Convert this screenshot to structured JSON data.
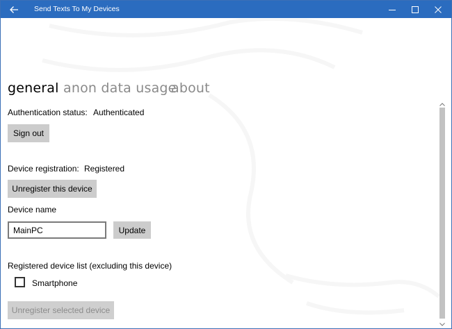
{
  "window": {
    "title": "Send Texts To My Devices",
    "accent_color": "#2b6cbf"
  },
  "titlebar": {
    "back_icon": "back-arrow-icon",
    "minimize_icon": "minimize-icon",
    "maximize_icon": "maximize-icon",
    "close_icon": "close-icon"
  },
  "pivot": {
    "tabs": [
      {
        "label": "general",
        "selected": true
      },
      {
        "label": "anon data usage",
        "selected": false
      },
      {
        "label": "about",
        "selected": false
      }
    ]
  },
  "auth": {
    "label": "Authentication status:",
    "value": "Authenticated",
    "sign_out_label": "Sign out"
  },
  "registration": {
    "label": "Device registration:",
    "value": "Registered",
    "unregister_label": "Unregister this device"
  },
  "device_name": {
    "label": "Device name",
    "value": "MainPC",
    "update_label": "Update"
  },
  "device_list": {
    "label": "Registered device list (excluding this device)",
    "items": [
      {
        "label": "Smartphone",
        "checked": false
      }
    ],
    "unregister_selected_label": "Unregister selected device"
  }
}
